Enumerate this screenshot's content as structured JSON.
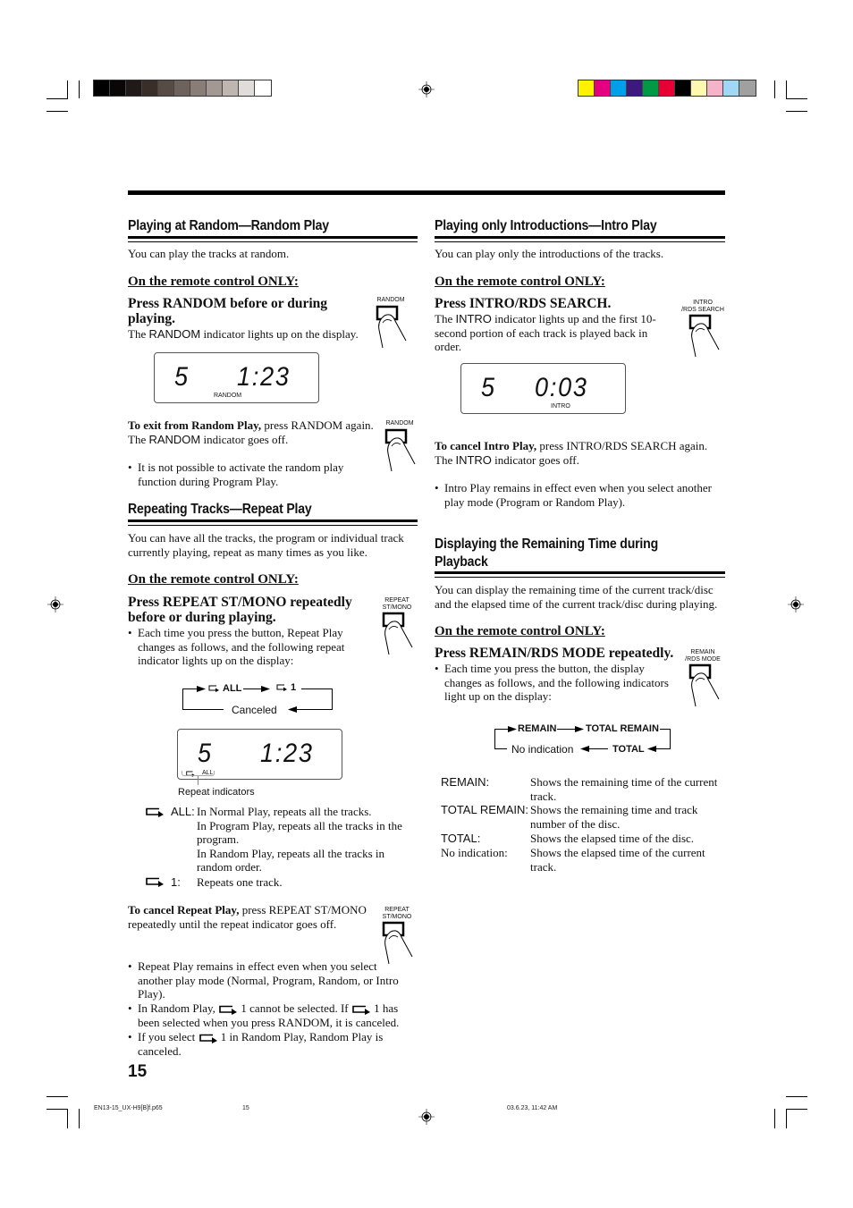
{
  "print_marks": {
    "grayscale_swatches": [
      "#000000",
      "#0a0606",
      "#1f1a17",
      "#3a2e29",
      "#574c45",
      "#6e625c",
      "#8a7c76",
      "#a49894",
      "#c0b6b1",
      "#e0dcd9",
      "#ffffff"
    ],
    "color_swatches": [
      "#fff200",
      "#e4007f",
      "#00a0e9",
      "#3c1a7d",
      "#009944",
      "#e60033",
      "#000000",
      "#fff9b0",
      "#f6b2c8",
      "#9fd7f5",
      "#a0a0a0"
    ]
  },
  "left": {
    "random": {
      "heading": "Playing at Random—Random Play",
      "intro": "You can play the tracks at random.",
      "remote_label": "On the remote control ONLY:",
      "step_title": "Press RANDOM before or during playing.",
      "step_desc_pre": "The ",
      "step_desc_key": "RANDOM",
      "step_desc_post": " indicator lights up on the display.",
      "button_label": "RANDOM",
      "display": {
        "track": "5",
        "time": "1:23",
        "indicator": "RANDOM"
      },
      "exit_bold": "To exit from Random Play,",
      "exit_rest": " press RANDOM again.",
      "exit_line2_pre": "The ",
      "exit_line2_key": "RANDOM",
      "exit_line2_post": " indicator goes off.",
      "exit_button_label": "RANDOM",
      "note": "It is not possible to activate the random play function during Program Play."
    },
    "repeat": {
      "heading": "Repeating Tracks—Repeat Play",
      "intro": "You can have all the tracks, the program or individual track currently playing, repeat as many times as you like.",
      "remote_label": "On the remote control ONLY:",
      "step_title": "Press REPEAT ST/MONO repeatedly before or during playing.",
      "button_label_1": "REPEAT",
      "button_label_2": "ST/MONO",
      "step_bullet": "Each time you press the button, Repeat Play changes as follows, and the following repeat indicator lights up on the display:",
      "flow": {
        "item1": "ALL",
        "item2": "1",
        "item3": "Canceled"
      },
      "display": {
        "track": "5",
        "time": "1:23",
        "indicator": "ALL"
      },
      "indicators_caption": "Repeat indicators",
      "defs": [
        {
          "term": "ALL:",
          "lines": [
            "In Normal Play, repeats all the tracks.",
            "In Program Play, repeats all the tracks in the program.",
            "In Random Play, repeats all the tracks in random order."
          ]
        },
        {
          "term": "1:",
          "lines": [
            "Repeats one track."
          ]
        }
      ],
      "cancel_bold": "To cancel Repeat Play,",
      "cancel_rest": " press REPEAT ST/MONO repeatedly until the repeat indicator goes off.",
      "notes": [
        "Repeat Play remains in effect even when you select another play mode (Normal, Program, Random, or Intro Play).",
        {
          "a": "In Random Play, ",
          "b": " 1 cannot be selected. If ",
          "c": " 1 has been selected when you press RANDOM, it is canceled."
        },
        {
          "a": "If you select ",
          "b": " 1 in Random Play, Random Play is canceled."
        }
      ]
    }
  },
  "right": {
    "intro": {
      "heading": "Playing only Introductions—Intro Play",
      "intro": "You can play only the introductions of the tracks.",
      "remote_label": "On the remote control ONLY:",
      "step_title": "Press INTRO/RDS SEARCH.",
      "step_desc_pre": "The ",
      "step_desc_key": "INTRO",
      "step_desc_post": " indicator lights up and the first 10-second portion of each track is played back in order.",
      "button_label_1": "INTRO",
      "button_label_2": "/RDS SEARCH",
      "display": {
        "track": "5",
        "time": "0:03",
        "indicator": "INTRO"
      },
      "cancel_bold": "To cancel Intro Play,",
      "cancel_rest": " press INTRO/RDS SEARCH again.",
      "cancel_line2_pre": "The ",
      "cancel_line2_key": "INTRO",
      "cancel_line2_post": " indicator goes off.",
      "note": "Intro Play remains in effect even when you select another play mode (Program or Random Play)."
    },
    "remain": {
      "heading_line1": "Displaying the Remaining Time during",
      "heading_line2": "Playback",
      "intro": "You can display the remaining time of the current track/disc and the elapsed time of the current track/disc during playing.",
      "remote_label": "On the remote control ONLY:",
      "step_title": "Press REMAIN/RDS MODE repeatedly.",
      "button_label_1": "REMAIN",
      "button_label_2": "/RDS MODE",
      "step_bullet": "Each time you press the button, the display changes as follows, and the following indicators light up on the display:",
      "flow": {
        "item1": "REMAIN",
        "item2": "TOTAL REMAIN",
        "item3": "TOTAL",
        "item4": "No indication"
      },
      "defs": [
        {
          "term": "REMAIN:",
          "desc": "Shows the remaining time of the current track."
        },
        {
          "term": "TOTAL REMAIN:",
          "desc": "Shows the remaining time and track number of the disc."
        },
        {
          "term": "TOTAL:",
          "desc": "Shows the elapsed time of the disc."
        },
        {
          "term": "No indication:",
          "desc": "Shows the elapsed time of the current track."
        }
      ]
    }
  },
  "page_number": "15",
  "footer": {
    "file": "EN13-15_UX-H9[B]f.p65",
    "page": "15",
    "timestamp": "03.6.23, 11:42 AM"
  }
}
